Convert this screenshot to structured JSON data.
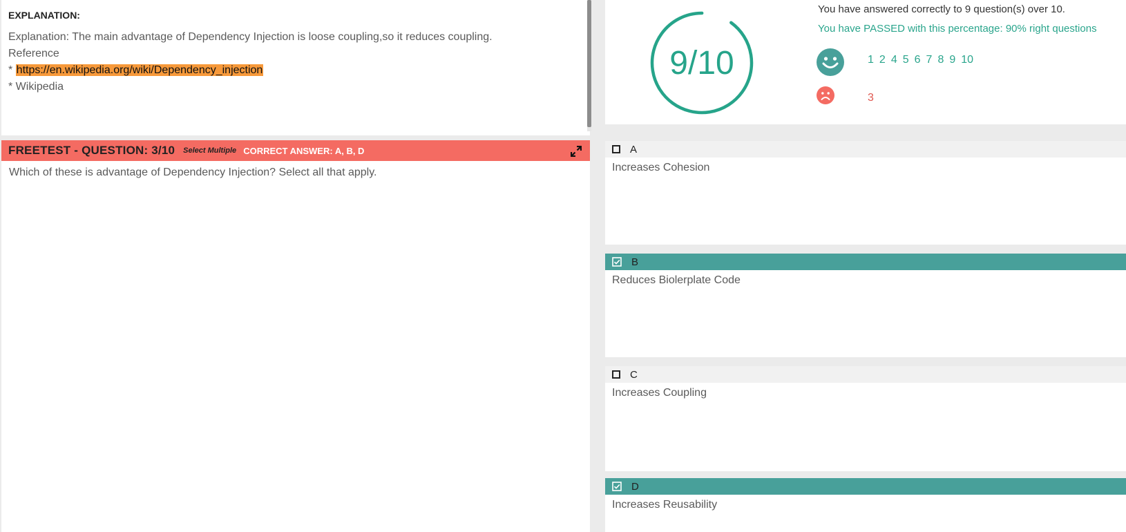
{
  "explanation": {
    "heading": "EXPLANATION:",
    "line1": "Explanation: The main advantage of Dependency Injection is loose coupling,so it reduces coupling.",
    "line2": "Reference",
    "bullet1_prefix": "* ",
    "link": "https://en.wikipedia.org/wiki/Dependency_injection",
    "bullet2": "* Wikipedia"
  },
  "question": {
    "title": "FREETEST - QUESTION: 3/10",
    "mode": "Select Multiple",
    "correct_answer": "CORRECT ANSWER: A, B, D",
    "text": "Which of these is advantage of Dependency Injection? Select all that apply."
  },
  "score": {
    "display": "9/10",
    "fraction": 0.9,
    "summary": "You have answered correctly to 9 question(s) over 10.",
    "passed": "You have PASSED with this percentage: 90% right questions",
    "correct_questions": [
      "1",
      "2",
      "4",
      "5",
      "6",
      "7",
      "8",
      "9",
      "10"
    ],
    "wrong_questions": [
      "3"
    ],
    "colors": {
      "correct": "#2aa58c",
      "wrong": "#e0574f",
      "header": "#f46b62",
      "selected": "#48a09a"
    }
  },
  "options": [
    {
      "letter": "A",
      "text": "Increases Cohesion",
      "checked": false
    },
    {
      "letter": "B",
      "text": "Reduces Biolerplate Code",
      "checked": true
    },
    {
      "letter": "C",
      "text": "Increases Coupling",
      "checked": false
    },
    {
      "letter": "D",
      "text": "Increases Reusability",
      "checked": true
    }
  ],
  "icons": {
    "expand": "expand-icon",
    "smile": "smile-icon",
    "sad": "sad-icon",
    "checkbox_checked": "checkbox-checked-icon",
    "checkbox_empty": "checkbox-empty-icon"
  }
}
